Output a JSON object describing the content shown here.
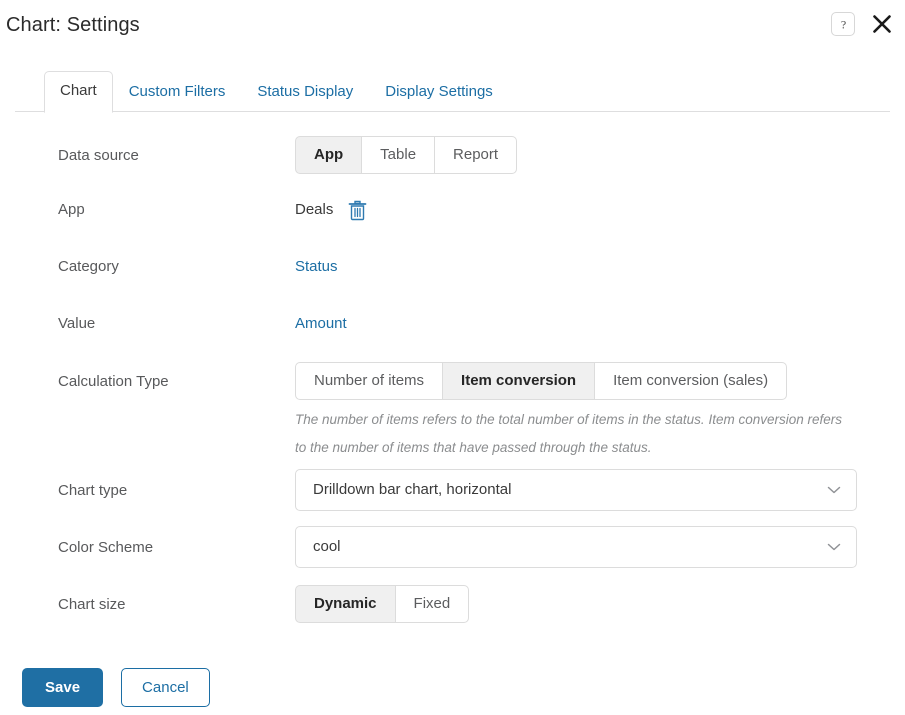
{
  "header": {
    "title": "Chart: Settings",
    "help_icon": "question-mark-icon",
    "close_icon": "close-icon"
  },
  "tabs": [
    {
      "label": "Chart",
      "active": true
    },
    {
      "label": "Custom Filters",
      "active": false
    },
    {
      "label": "Status Display",
      "active": false
    },
    {
      "label": "Display Settings",
      "active": false
    }
  ],
  "fields": {
    "data_source": {
      "label": "Data source",
      "options": [
        "App",
        "Table",
        "Report"
      ],
      "selected": "App"
    },
    "app": {
      "label": "App",
      "value": "Deals",
      "delete_icon": "trash-icon"
    },
    "category": {
      "label": "Category",
      "value": "Status"
    },
    "value": {
      "label": "Value",
      "value": "Amount"
    },
    "calculation_type": {
      "label": "Calculation Type",
      "options": [
        "Number of items",
        "Item conversion",
        "Item conversion (sales)"
      ],
      "selected": "Item conversion",
      "helper_text": "The number of items refers to the total number of items in the status. Item conversion refers to the number of items that have passed through the status."
    },
    "chart_type": {
      "label": "Chart type",
      "value": "Drilldown bar chart, horizontal",
      "chevron_icon": "chevron-down-icon"
    },
    "color_scheme": {
      "label": "Color Scheme",
      "value": "cool",
      "chevron_icon": "chevron-down-icon"
    },
    "chart_size": {
      "label": "Chart size",
      "options": [
        "Dynamic",
        "Fixed"
      ],
      "selected": "Dynamic"
    }
  },
  "footer": {
    "save_label": "Save",
    "cancel_label": "Cancel"
  },
  "colors": {
    "accent_blue": "#1c6ea4",
    "link_blue": "#1c6ea4",
    "label_grey": "#58595b",
    "border_grey": "#dcdcdc",
    "selected_bg": "#f0f0f0"
  }
}
